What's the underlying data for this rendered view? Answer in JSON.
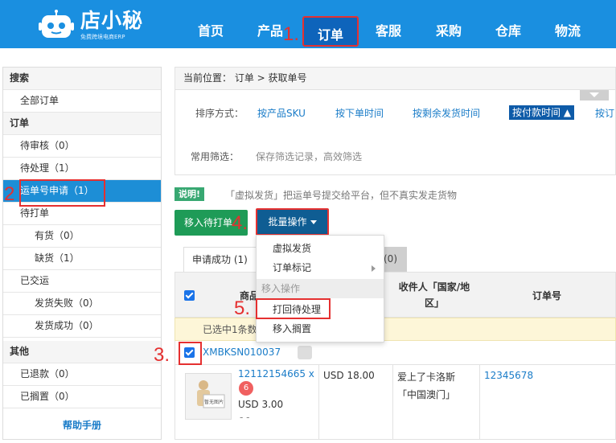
{
  "app": {
    "logo_name": "店小秘",
    "logo_sub": "免费跨境电商ERP"
  },
  "nav": {
    "items": [
      {
        "label": "首页"
      },
      {
        "label": "产品"
      },
      {
        "label": "订单"
      },
      {
        "label": "客服"
      },
      {
        "label": "采购"
      },
      {
        "label": "仓库"
      },
      {
        "label": "物流"
      }
    ],
    "active": "订单"
  },
  "sidebar": {
    "sections": [
      {
        "label": "搜索",
        "type": "header"
      },
      {
        "label": "全部订单"
      },
      {
        "label": "订单",
        "type": "header"
      },
      {
        "label": "待审核",
        "count": "（0）"
      },
      {
        "label": "待处理",
        "count": "（1）"
      },
      {
        "label": "运单号申请",
        "count": "（1）",
        "active": true
      },
      {
        "label": "待打单"
      },
      {
        "label": "有货",
        "count": "（0）",
        "sub": true
      },
      {
        "label": "缺货",
        "count": "（1）",
        "sub": true
      },
      {
        "label": "已交运"
      },
      {
        "label": "发货失败",
        "count": "（0）",
        "sub": true
      },
      {
        "label": "发货成功",
        "count": "（0）",
        "sub": true
      },
      {
        "label": "其他",
        "type": "header"
      },
      {
        "label": "已退款",
        "count": "（0）"
      },
      {
        "label": "已搁置",
        "count": "（0）"
      }
    ],
    "help": "帮助手册"
  },
  "breadcrumb": "当前位置： 订单 > 获取单号",
  "filters": {
    "sort_label": "排序方式：",
    "sort_options": [
      "按产品SKU",
      "按下单时间",
      "按剩余发货时间",
      "按付款时间",
      "按订"
    ],
    "sort_active": "按付款时间",
    "common_label": "常用筛选：",
    "common_hint": "保存筛选记录，高效筛选"
  },
  "notice": {
    "badge": "说明!",
    "text": "「虚拟发货」把运单号提交给平台，但不真实发走货物"
  },
  "actions": {
    "move_print": "移入待打单",
    "batch": "批量操作"
  },
  "dropdown": {
    "items": [
      "虚拟发货",
      "订单标记"
    ],
    "group": "移入操作",
    "group_items": [
      "打回待处理",
      "移入搁置"
    ]
  },
  "tabs": {
    "success": "申请成功 (1)",
    "other": "(0)"
  },
  "table": {
    "headers": [
      "商品",
      "收件人「国家/地区」",
      "订单号"
    ],
    "selected_text": "已选中1条数",
    "order": {
      "id": "XMBKSN010037",
      "sku_line": "12112154665 x",
      "qty": "6",
      "price": "USD 3.00",
      "price_sub": "- -",
      "amount": "USD 18.00",
      "recipient": "爱上了卡洛斯",
      "country": "「中国澳门」",
      "order_no": "12345678",
      "thumb_text": "暂无图片"
    }
  },
  "annotations": {
    "steps": [
      "1.",
      "2",
      "3.",
      "4.",
      "5."
    ]
  }
}
